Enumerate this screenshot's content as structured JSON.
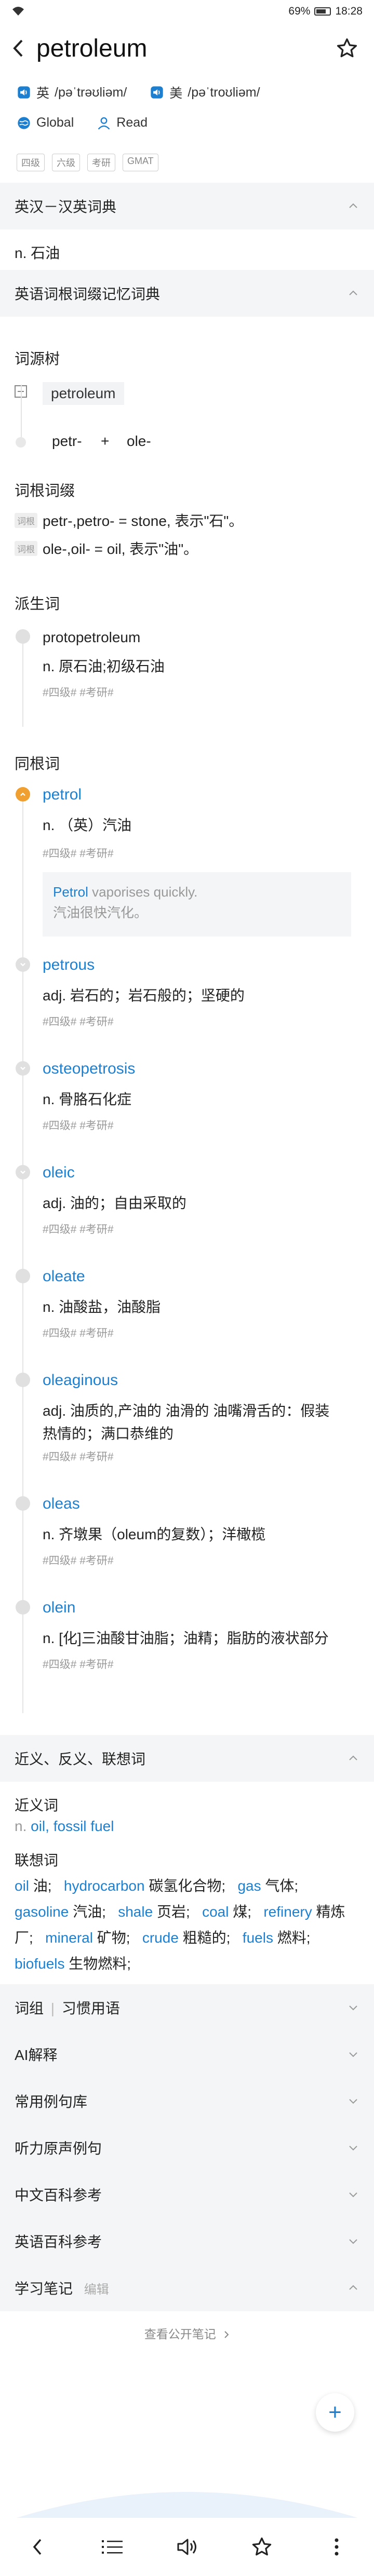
{
  "status": {
    "battery": "69%",
    "time": "18:28"
  },
  "word": "petroleum",
  "pron": {
    "uk_label": "英",
    "uk": "/pəˈtrəʊliəm/",
    "us_label": "美",
    "us": "/pəˈtroʊliəm/"
  },
  "modes": {
    "global": "Global",
    "read": "Read"
  },
  "tags": [
    "四级",
    "六级",
    "考研",
    "GMAT"
  ],
  "sections": {
    "dict": "英汉－汉英词典",
    "dict_def": "n. 石油",
    "etym": "英语词根词缀记忆词典",
    "tree_title": "词源树",
    "tree_root": "petroleum",
    "tree_part1": "petr-",
    "tree_plus": "+",
    "tree_part2": "ole-",
    "affix_title": "词根词缀",
    "affix_tag": "词根",
    "affix1": "petr-,petro- = stone, 表示\"石\"。",
    "affix2": "ole-,oil- = oil, 表示\"油\"。",
    "derived_title": "派生词",
    "synonym_title": "同根词",
    "near": "近义、反义、联想词",
    "near_sub": "近义词",
    "near_pos": "n.",
    "near_words": "oil, fossil fuel",
    "assoc_sub": "联想词",
    "phrases": "词组",
    "phrases_sep": "|",
    "idioms": "习惯用语",
    "ai": "AI解释",
    "examples": "常用例句库",
    "audio": "听力原声例句",
    "zh_wiki": "中文百科参考",
    "en_wiki": "英语百科参考",
    "notes": "学习笔记",
    "notes_edit": "编辑",
    "view_notes": "查看公开笔记"
  },
  "derived": [
    {
      "word": "protopetroleum",
      "def": "n. 原石油;初级石油",
      "tags": "#四级# #考研#"
    }
  ],
  "cognates": [
    {
      "word": "petrol",
      "def": "n. （英）汽油",
      "tags": "#四级# #考研#"
    },
    {
      "word": "petrous",
      "def": "adj. 岩石的；岩石般的；坚硬的",
      "tags": "#四级# #考研#"
    },
    {
      "word": "osteopetrosis",
      "def": "n. 骨胳石化症",
      "tags": "#四级# #考研#"
    },
    {
      "word": "oleic",
      "def": "adj. 油的；自由采取的",
      "tags": "#四级# #考研#"
    },
    {
      "word": "oleate",
      "def": "n. 油酸盐，油酸脂",
      "tags": "#四级# #考研#"
    },
    {
      "word": "oleaginous",
      "def1": "adj. 油质的,产油的 油滑的 油嘴滑舌的：假装",
      "def2": "热情的；满口恭维的",
      "tags": "#四级# #考研#"
    },
    {
      "word": "oleas",
      "def": "n. 齐墩果（oleum的复数）；洋橄榄",
      "tags": "#四级# #考研#"
    },
    {
      "word": "olein",
      "def": "n. [化]三油酸甘油脂；油精；脂肪的液状部分",
      "tags": "#四级# #考研#"
    }
  ],
  "sentence": {
    "hl": "Petrol",
    "rest": " vaporises quickly.",
    "zh": "汽油很快汽化。"
  },
  "assoc": [
    {
      "w": "oil",
      "m": "油;"
    },
    {
      "w": "hydrocarbon",
      "m": "碳氢化合物;"
    },
    {
      "w": "gas",
      "m": "气体;"
    },
    {
      "w": "gasoline",
      "m": "汽油;"
    },
    {
      "w": "shale",
      "m": "页岩;"
    },
    {
      "w": "coal",
      "m": "煤;"
    },
    {
      "w": "refinery",
      "m": "精炼厂;"
    },
    {
      "w": "mineral",
      "m": "矿物;"
    },
    {
      "w": "crude",
      "m": "粗糙的;"
    },
    {
      "w": "fuels",
      "m": "燃料;"
    },
    {
      "w": "biofuels",
      "m": "生物燃料;"
    }
  ],
  "colors": {
    "accent": "#1d7fcf",
    "active_dot": "#f0a030",
    "section_bg": "#f4f5f6"
  }
}
